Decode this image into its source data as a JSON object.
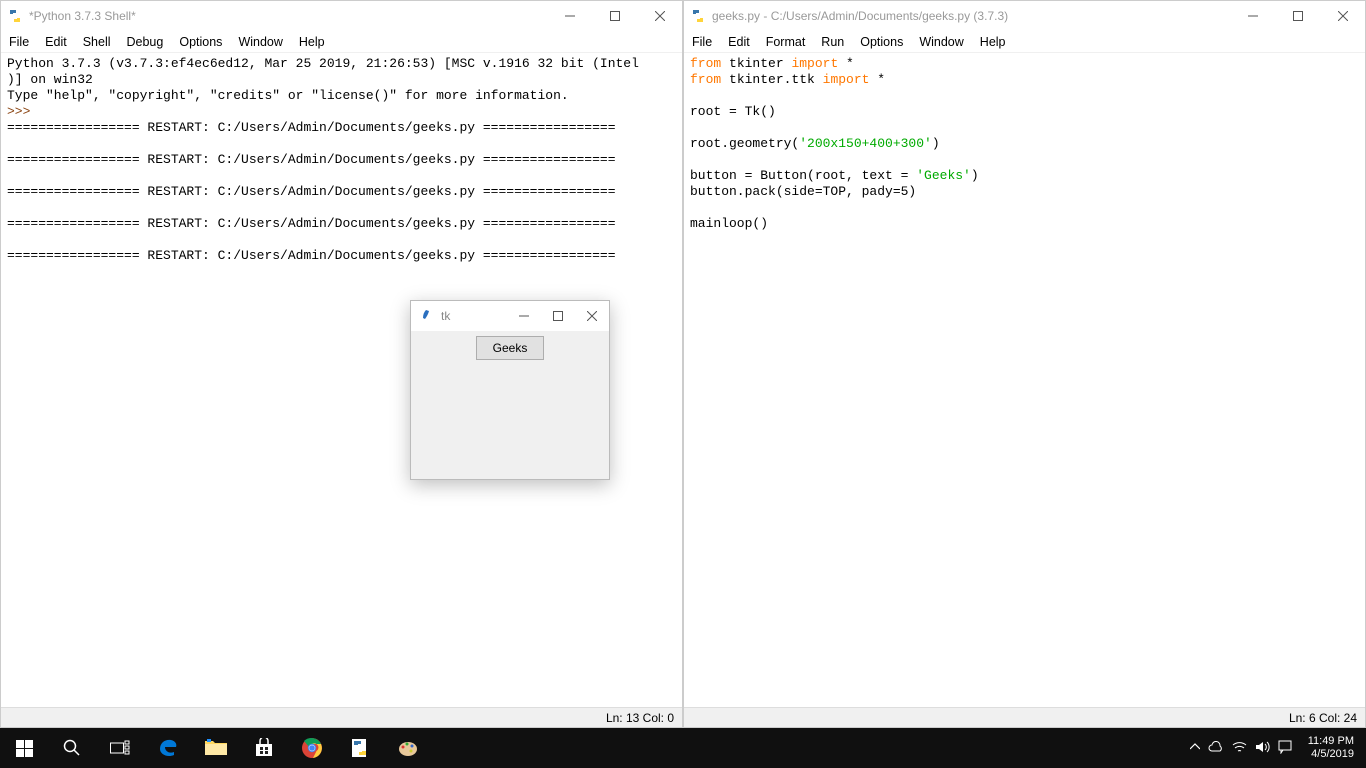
{
  "shell": {
    "title": "*Python 3.7.3 Shell*",
    "menu": [
      "File",
      "Edit",
      "Shell",
      "Debug",
      "Options",
      "Window",
      "Help"
    ],
    "lines": {
      "l1": "Python 3.7.3 (v3.7.3:ef4ec6ed12, Mar 25 2019, 21:26:53) [MSC v.1916 32 bit (Intel",
      "l2": ")] on win32",
      "l3": "Type \"help\", \"copyright\", \"credits\" or \"license()\" for more information.",
      "prompt": ">>> ",
      "restart": "================= RESTART: C:/Users/Admin/Documents/geeks.py ================="
    },
    "status": "Ln: 13  Col: 0"
  },
  "editor": {
    "title": "geeks.py - C:/Users/Admin/Documents/geeks.py (3.7.3)",
    "menu": [
      "File",
      "Edit",
      "Format",
      "Run",
      "Options",
      "Window",
      "Help"
    ],
    "code": {
      "from": "from",
      "import": "import",
      "l1a": " tkinter ",
      "l1b": " *",
      "l2a": " tkinter.ttk ",
      "l2b": " *",
      "l4": "root = Tk()",
      "l6a": "root.geometry(",
      "l6b": "'200x150+400+300'",
      "l6c": ")",
      "l8a": "button = Button(root, text = ",
      "l8b": "'Geeks'",
      "l8c": ")",
      "l9": "button.pack(side=TOP, pady=5)",
      "l11": "mainloop()"
    },
    "status": "Ln: 6  Col: 24"
  },
  "tk": {
    "title": "tk",
    "button": "Geeks"
  },
  "taskbar": {
    "time": "11:49 PM",
    "date": "4/5/2019"
  }
}
